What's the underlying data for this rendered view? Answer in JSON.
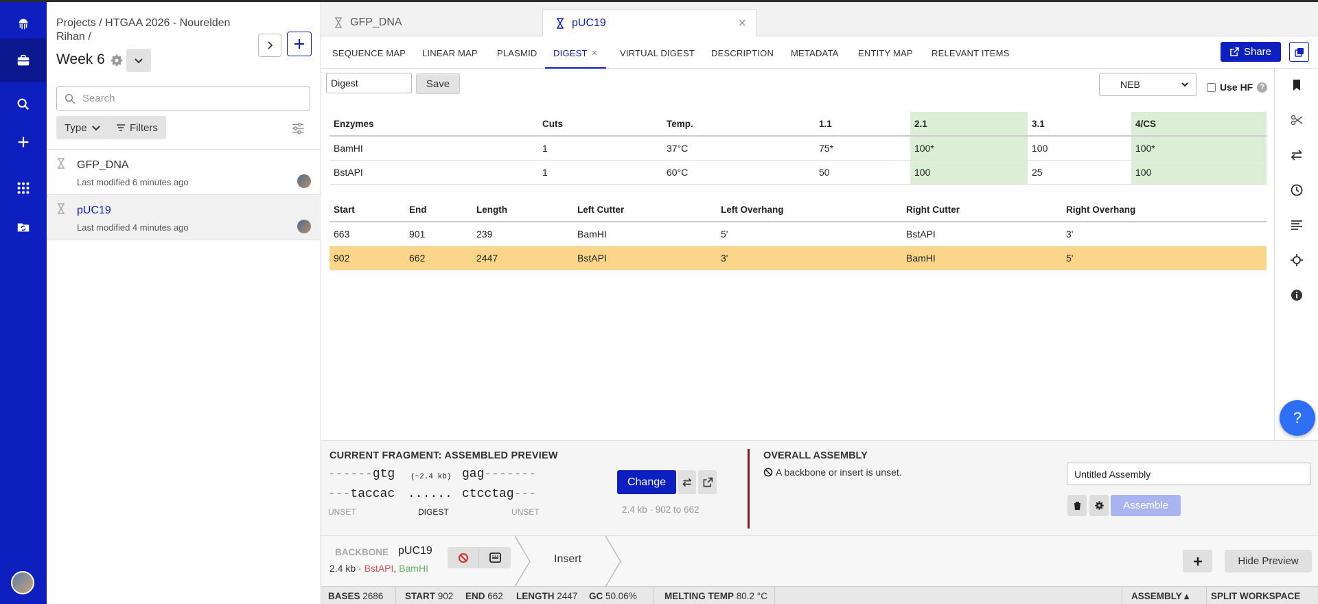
{
  "rail": {
    "items": [
      "logo",
      "projects",
      "search",
      "create",
      "apps",
      "folder-sync"
    ]
  },
  "panel": {
    "breadcrumb": "Projects / HTGAA 2026 - Nourelden Rihan /",
    "week_title": "Week 6",
    "search_placeholder": "Search",
    "type_label": "Type",
    "filters_label": "Filters",
    "items": [
      {
        "name": "GFP_DNA",
        "modified": "Last modified 6 minutes ago"
      },
      {
        "name": "pUC19",
        "modified": "Last modified 4 minutes ago"
      }
    ]
  },
  "doc_tabs": [
    {
      "label": "GFP_DNA"
    },
    {
      "label": "pUC19"
    }
  ],
  "nav_tabs": [
    "SEQUENCE MAP",
    "LINEAR MAP",
    "PLASMID",
    "DIGEST",
    "VIRTUAL DIGEST",
    "DESCRIPTION",
    "METADATA",
    "ENTITY MAP",
    "RELEVANT ITEMS"
  ],
  "share_label": "Share",
  "digest": {
    "name_value": "Digest",
    "save_label": "Save",
    "vendor": "NEB",
    "use_hf_label": "Use HF",
    "enzyme_headers": [
      "Enzymes",
      "Cuts",
      "Temp.",
      "1.1",
      "2.1",
      "3.1",
      "4/CS"
    ],
    "enzyme_rows": [
      [
        "BamHI",
        "1",
        "37°C",
        "75*",
        "100*",
        "100",
        "100*"
      ],
      [
        "BstAPI",
        "1",
        "60°C",
        "50",
        "100",
        "25",
        "100"
      ]
    ],
    "fragment_headers": [
      "Start",
      "End",
      "Length",
      "Left Cutter",
      "Left Overhang",
      "Right Cutter",
      "Right Overhang"
    ],
    "fragment_rows": [
      [
        "663",
        "901",
        "239",
        "BamHI",
        "5'",
        "BstAPI",
        "3'"
      ],
      [
        "902",
        "662",
        "2447",
        "BstAPI",
        "3'",
        "BamHI",
        "5'"
      ]
    ]
  },
  "assembly": {
    "current_title": "CURRENT FRAGMENT: ASSEMBLED PREVIEW",
    "top_left_dash": "------",
    "top_left_seq": "gtg",
    "size_note": "(~2.4 kb)",
    "top_right_seq": "gag",
    "top_right_dash": "-------",
    "bot_left_dash": "---",
    "bot_left_seq": "taccac",
    "dots": "......",
    "bot_right_seq": "ctcctag",
    "bot_right_dash": "---",
    "unset_left": "UNSET",
    "digest_label": "DIGEST",
    "unset_right": "UNSET",
    "change_label": "Change",
    "fragment_info": "2.4 kb · 902 to 662",
    "overall_title": "OVERALL ASSEMBLY",
    "overall_msg": "A backbone or insert is unset.",
    "assembly_name": "Untitled Assembly",
    "assemble_label": "Assemble",
    "backbone_label": "BACKBONE",
    "backbone_name": "pUC19",
    "backbone_size": "2.4 kb ·",
    "backbone_enz1": "BstAPI",
    "backbone_comma": ",",
    "backbone_enz2": "BamHI",
    "insert_label": "Insert",
    "hide_preview_label": "Hide Preview"
  },
  "status": {
    "bases_label": "BASES",
    "bases": "2686",
    "start_label": "START",
    "start": "902",
    "end_label": "END",
    "end": "662",
    "length_label": "LENGTH",
    "length": "2447",
    "gc_label": "GC",
    "gc": "50.06%",
    "melting_label": "MELTING TEMP",
    "melting": "80.2 °C",
    "assembly_label": "ASSEMBLY ▴",
    "split_label": "SPLIT WORKSPACE"
  },
  "colors": {
    "brand": "#0d1fbf",
    "highlight_row": "#fad58a",
    "buffer_green": "#dcefd6",
    "divider_red": "#8b1a1a"
  }
}
